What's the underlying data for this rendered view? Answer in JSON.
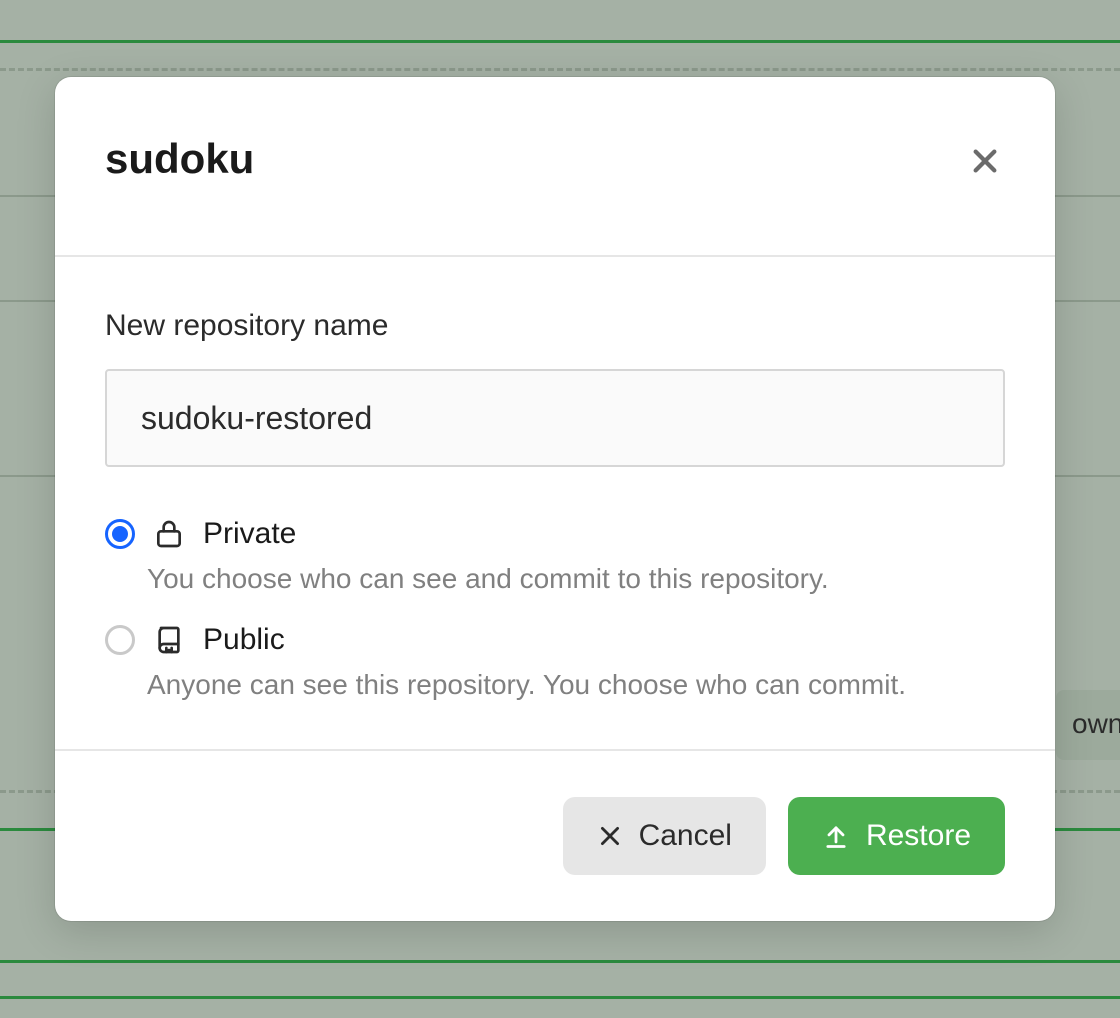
{
  "modal": {
    "title": "sudoku",
    "repo_name_label": "New repository name",
    "repo_name_value": "sudoku-restored",
    "visibility": {
      "private": {
        "label": "Private",
        "description": "You choose who can see and commit to this repository.",
        "selected": true
      },
      "public": {
        "label": "Public",
        "description": "Anyone can see this repository. You choose who can commit.",
        "selected": false
      }
    },
    "buttons": {
      "cancel": "Cancel",
      "restore": "Restore"
    }
  },
  "background": {
    "partial_button_text": "ownl"
  },
  "colors": {
    "accent_green": "#4caf50",
    "radio_blue": "#1664ff",
    "bg_tint": "#a5b1a5"
  }
}
